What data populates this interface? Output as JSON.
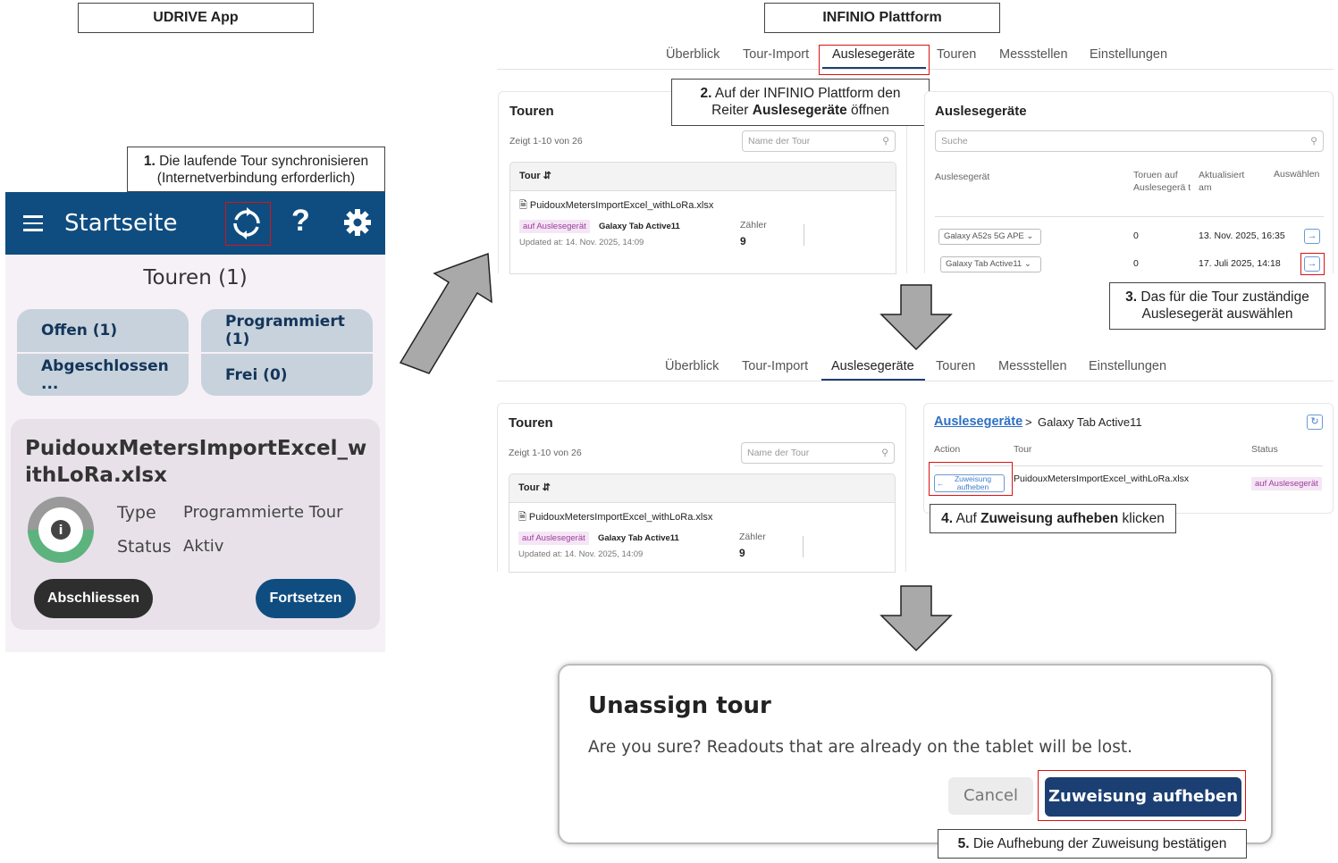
{
  "headers": {
    "app": "UDRIVE App",
    "platform": "INFINIO Plattform"
  },
  "steps": {
    "s1_num": "1.",
    "s1_text": "Die laufende Tour synchronisieren",
    "s1_line2": "(Internetverbindung erforderlich)",
    "s2_num": "2.",
    "s2_text": "Auf der INFINIO Plattform den",
    "s2_line2a": "Reiter ",
    "s2_line2b": "Auslesegeräte",
    "s2_line2c": " öffnen",
    "s3_num": "3.",
    "s3_text": "Das für die Tour zuständige",
    "s3_line2": "Auslesegerät auswählen",
    "s4_num": "4.",
    "s4_a": "Auf ",
    "s4_b": "Zuweisung aufheben",
    "s4_c": " klicken",
    "s5_num": "5.",
    "s5_text": "Die Aufhebung der Zuweisung bestätigen"
  },
  "app": {
    "title": "Startseite",
    "section_title": "Touren (1)",
    "filters": [
      "Offen (1)",
      "Programmiert (1)",
      "Abgeschlossen ...",
      "Frei (0)"
    ],
    "tour_name": "PuidouxMetersImportExcel_withLoRa.xlsx",
    "type_label": "Type",
    "type_value": "Programmierte Tour",
    "status_label": "Status",
    "status_value": "Aktiv",
    "btn_close": "Abschliessen",
    "btn_continue": "Fortsetzen",
    "progress": 0.5,
    "colors": {
      "appbar": "#0f4d80",
      "progress": "#5db37e"
    }
  },
  "platform": {
    "tabs": [
      "Überblick",
      "Tour-Import",
      "Auslesegeräte",
      "Touren",
      "Messstellen",
      "Einstellungen"
    ],
    "active_tab": "Auslesegeräte",
    "tours_title": "Touren",
    "tours_count": "Zeigt 1-10 von 26",
    "tours_search": "Name der Tour",
    "tours_col": "Tour",
    "tour_file": "PuidouxMetersImportExcel_withLoRa.xlsx",
    "tour_tag": "auf Auslesegerät",
    "tour_device": "Galaxy Tab Active11",
    "tour_updated": "Updated at: 14. Nov. 2025, 14:09",
    "counter_label": "Zähler",
    "counter_value": "9",
    "devices_title": "Auslesegeräte",
    "devices_search": "Suche",
    "devices_cols": [
      "Auslesegerät",
      "Toruen auf Auslesegerä t",
      "Aktualisiert am",
      "Auswählen"
    ],
    "devices": [
      {
        "name": "Galaxy A52s 5G APE",
        "tours": "0",
        "updated": "13. Nov. 2025, 16:35"
      },
      {
        "name": "Galaxy Tab Active11",
        "tours": "0",
        "updated": "17. Juli 2025, 14:18"
      }
    ],
    "detail_link": "Auslesegeräte",
    "detail_sep": ">",
    "detail_device": "Galaxy Tab Active11",
    "detail_cols": [
      "Action",
      "Tour",
      "Status"
    ],
    "detail_action": "Zuweisung aufheben",
    "detail_tour": "PuidouxMetersImportExcel_withLoRa.xlsx",
    "detail_status": "auf Auslesegerät"
  },
  "dialog": {
    "title": "Unassign tour",
    "message": "Are you sure? Readouts that are already on the tablet will be lost.",
    "cancel": "Cancel",
    "confirm": "Zuweisung aufheben"
  }
}
